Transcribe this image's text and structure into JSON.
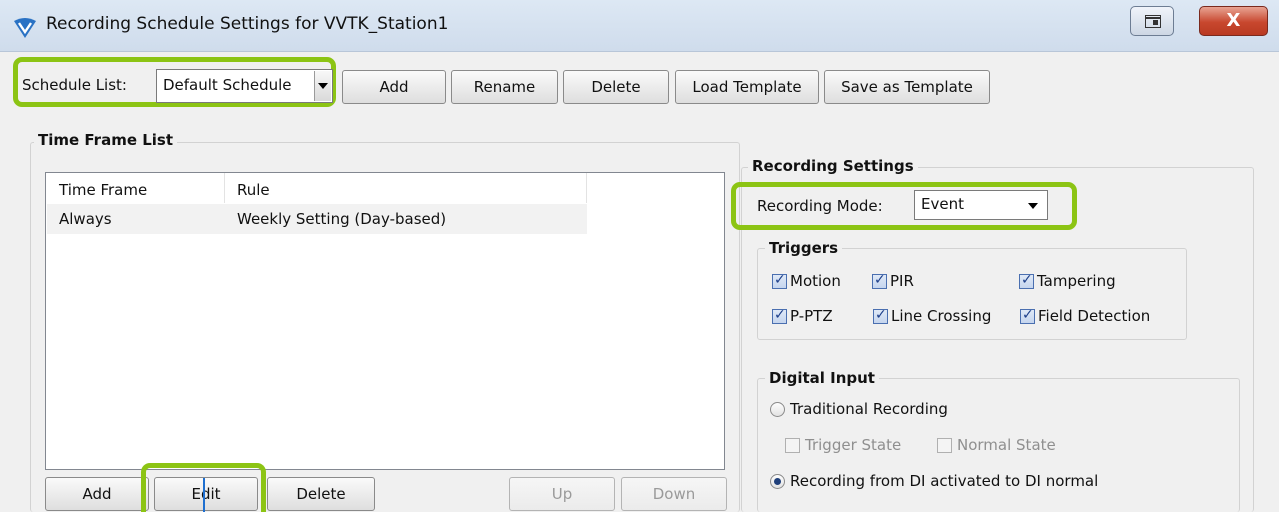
{
  "window": {
    "title": "Recording Schedule Settings for VVTK_Station1",
    "close_glyph": "X"
  },
  "toolbar": {
    "schedule_list_label": "Schedule List:",
    "schedule_value": "Default Schedule",
    "add_label": "Add",
    "rename_label": "Rename",
    "delete_label": "Delete",
    "load_template_label": "Load Template",
    "save_template_label": "Save as Template"
  },
  "time_frame": {
    "group_title": "Time Frame List",
    "columns": [
      "Time Frame",
      "Rule"
    ],
    "rows": [
      {
        "time_frame": "Always",
        "rule": "Weekly Setting (Day-based)"
      }
    ],
    "add_label": "Add",
    "edit_label": "Edit",
    "delete_label": "Delete",
    "up_label": "Up",
    "down_label": "Down"
  },
  "recording": {
    "group_title": "Recording Settings",
    "mode_label": "Recording Mode:",
    "mode_value": "Event"
  },
  "triggers": {
    "group_title": "Triggers",
    "items": [
      {
        "label": "Motion",
        "checked": true
      },
      {
        "label": "PIR",
        "checked": true
      },
      {
        "label": "Tampering",
        "checked": true
      },
      {
        "label": "P-PTZ",
        "checked": true
      },
      {
        "label": "Line Crossing",
        "checked": true
      },
      {
        "label": "Field Detection",
        "checked": true
      }
    ]
  },
  "digital_input": {
    "group_title": "Digital Input",
    "traditional_label": "Traditional Recording",
    "trigger_state_label": "Trigger State",
    "normal_state_label": "Normal State",
    "di_activated_label": "Recording from DI activated to DI normal"
  },
  "colors": {
    "highlight": "#8cc414",
    "title_bar": "#d6e2f0",
    "close_button": "#c8472e",
    "annotation_line": "#1e6fd0"
  }
}
